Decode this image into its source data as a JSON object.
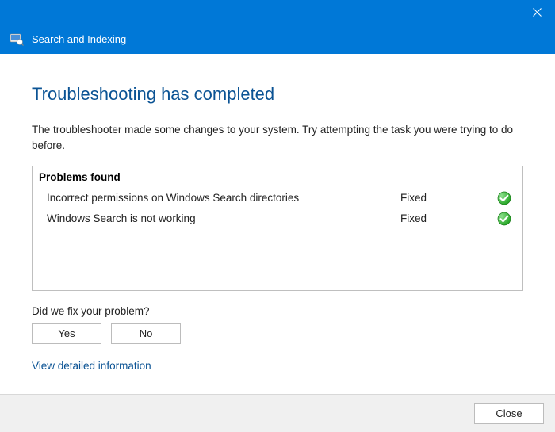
{
  "header": {
    "title": "Search and Indexing"
  },
  "main": {
    "heading": "Troubleshooting has completed",
    "description": "The troubleshooter made some changes to your system. Try attempting the task you were trying to do before."
  },
  "problems": {
    "header": "Problems found",
    "items": [
      {
        "name": "Incorrect permissions on Windows Search directories",
        "status": "Fixed"
      },
      {
        "name": "Windows Search is not working",
        "status": "Fixed"
      }
    ]
  },
  "feedback": {
    "question": "Did we fix your problem?",
    "yes_label": "Yes",
    "no_label": "No"
  },
  "detail_link": "View detailed information",
  "footer": {
    "close_label": "Close"
  }
}
